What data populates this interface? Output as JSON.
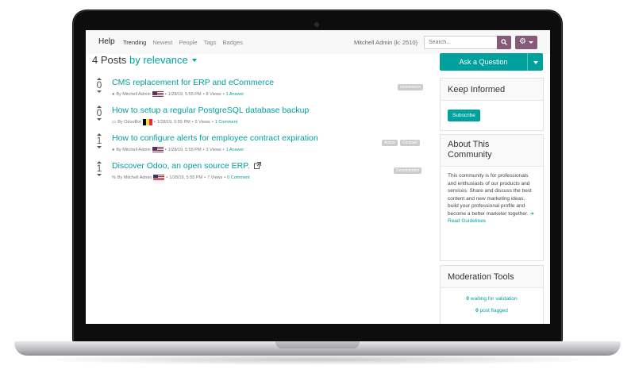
{
  "nav": {
    "brand": "Help",
    "links": [
      "Trending",
      "Newest",
      "People",
      "Tags",
      "Badges"
    ],
    "user": "Mitchell Admin (k: 2510)",
    "search_placeholder": "Search..."
  },
  "heading": {
    "count": "4 Posts",
    "sort": "by relevance"
  },
  "posts": [
    {
      "votes": "0",
      "title": "CMS replacement for ERP and eCommerce",
      "by": "By Mitchell Admin",
      "flag": "us",
      "date": "1/28/19, 5:55 PM",
      "views": "8 Views",
      "answers": "1 Answer",
      "tags": [
        "ecommerce"
      ]
    },
    {
      "votes": "0",
      "title": "How to setup a regular PostgreSQL database backup",
      "by": "By OdooBot",
      "flag": "be",
      "date": "1/28/19, 5:55 PM",
      "views": "5 Views",
      "answers": "1 Comment",
      "tags": []
    },
    {
      "votes": "1",
      "title": "How to configure alerts for employee contract expiration",
      "by": "By Mitchell Admin",
      "flag": "us",
      "date": "1/28/19, 5:55 PM",
      "views": "3 Views",
      "answers": "1 Answer",
      "tags": [
        "Action",
        "Contract"
      ]
    },
    {
      "votes": "1",
      "title": "Discover Odoo, an open source ERP.",
      "by": "By Mitchell Admin",
      "flag": "us",
      "date": "1/28/19, 5:55 PM",
      "views": "7 Views",
      "answers": "0 Comment",
      "tags": [
        "Development"
      ]
    }
  ],
  "sidebar": {
    "ask_label": "Ask a Question",
    "keep_title": "Keep Informed",
    "subscribe_label": "Subscribe",
    "about_title": "About This Community",
    "about_text": "This community is for professionals and enthusiasts of our products and services. Share and discuss the best content and new marketing ideas, build your professional profile and become a better marketer together.",
    "about_link": "Read Guidelines",
    "mod_title": "Moderation Tools",
    "waiting_count": "0",
    "waiting_label": "waiting for validation",
    "flagged_count": "0",
    "flagged_label": "post flagged"
  },
  "colors": {
    "accent": "#00a09d",
    "brand": "#875a7b"
  }
}
